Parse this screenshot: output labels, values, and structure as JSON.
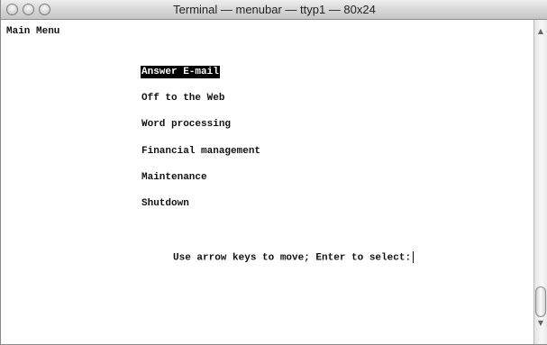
{
  "window": {
    "title": "Terminal — menubar — ttyp1 — 80x24"
  },
  "terminal": {
    "header": "Main Menu",
    "menu_items": [
      {
        "label": "Answer E-mail",
        "selected": true
      },
      {
        "label": "Off to the Web",
        "selected": false
      },
      {
        "label": "Word processing",
        "selected": false
      },
      {
        "label": "Financial management",
        "selected": false
      },
      {
        "label": "Maintenance",
        "selected": false
      },
      {
        "label": "Shutdown",
        "selected": false
      }
    ],
    "hint": "Use arrow keys to move; Enter to select:"
  },
  "icons": {
    "close": "close-button",
    "minimize": "minimize-button",
    "zoom": "zoom-button",
    "scroll_up": "scroll-up-arrow-icon",
    "scroll_down": "scroll-down-arrow-icon"
  },
  "colors": {
    "selection_background": "#000000",
    "selection_text": "#ffffff",
    "terminal_text": "#111111",
    "terminal_background": "#ffffff"
  }
}
